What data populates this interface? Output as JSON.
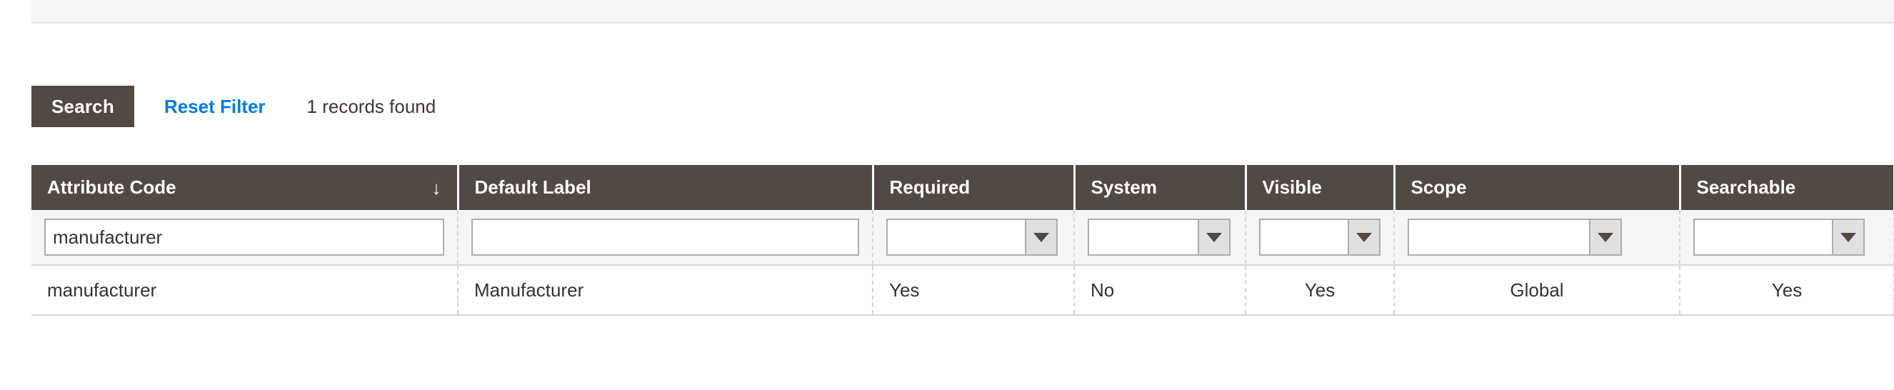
{
  "colors": {
    "header_bg": "#514943",
    "link_blue": "#007bdb",
    "filter_row_bg": "#f5f5f5",
    "page_bg": "#ffffff",
    "border_gray": "#d6d6d6"
  },
  "toolbar": {
    "search_label": "Search",
    "reset_filter_label": "Reset Filter",
    "records_found": "1 records found"
  },
  "grid": {
    "columns": [
      {
        "label": "Attribute Code",
        "sort_arrow": "↓",
        "filter_type": "text",
        "filter_value": "manufacturer",
        "filter_placeholder": "",
        "align": "left"
      },
      {
        "label": "Default Label",
        "sort_arrow": "",
        "filter_type": "text",
        "filter_value": "",
        "filter_placeholder": "",
        "align": "left"
      },
      {
        "label": "Required",
        "sort_arrow": "",
        "filter_type": "select",
        "filter_value": "",
        "filter_placeholder": "",
        "align": "left"
      },
      {
        "label": "System",
        "sort_arrow": "",
        "filter_type": "select",
        "filter_value": "",
        "filter_placeholder": "",
        "align": "left"
      },
      {
        "label": "Visible",
        "sort_arrow": "",
        "filter_type": "select",
        "filter_value": "",
        "filter_placeholder": "",
        "align": "left"
      },
      {
        "label": "Scope",
        "sort_arrow": "",
        "filter_type": "select",
        "filter_value": "",
        "filter_placeholder": "",
        "align": "center"
      },
      {
        "label": "Searchable",
        "sort_arrow": "",
        "filter_type": "select",
        "filter_value": "",
        "filter_placeholder": "",
        "align": "center"
      }
    ],
    "rows": [
      {
        "attribute_code": "manufacturer",
        "default_label": "Manufacturer",
        "required": "Yes",
        "system": "No",
        "visible": "Yes",
        "scope": "Global",
        "searchable": "Yes"
      }
    ]
  }
}
